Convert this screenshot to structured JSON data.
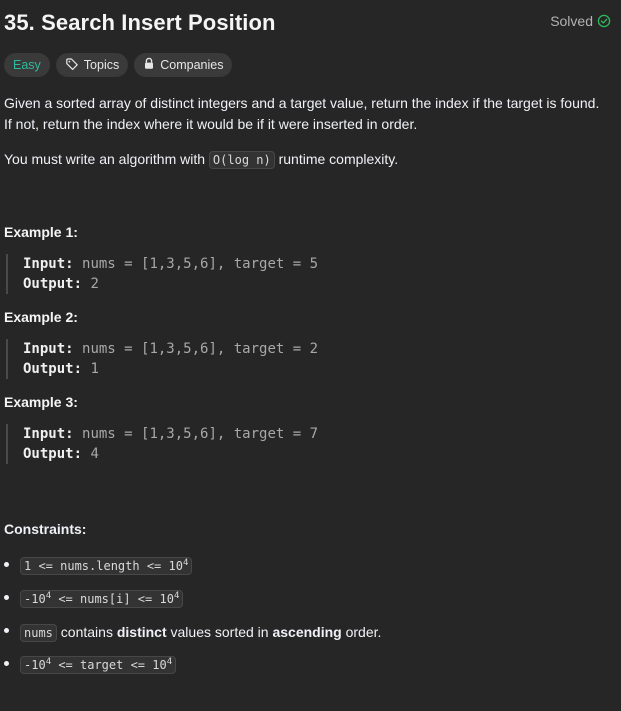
{
  "header": {
    "title": "35. Search Insert Position",
    "solved_label": "Solved"
  },
  "tags": {
    "difficulty": "Easy",
    "topics": "Topics",
    "companies": "Companies"
  },
  "description": {
    "line1": "Given a sorted array of distinct integers and a target value, return the index if the target is found.",
    "line2": "If not, return the index where it would be if it were inserted in order.",
    "p2_prefix": "You must write an algorithm with ",
    "p2_code": "O(log n)",
    "p2_suffix": " runtime complexity."
  },
  "examples": [
    {
      "title": "Example 1:",
      "input_label": "Input:",
      "input_value": "nums = [1,3,5,6], target = 5",
      "output_label": "Output:",
      "output_value": "2"
    },
    {
      "title": "Example 2:",
      "input_label": "Input:",
      "input_value": "nums = [1,3,5,6], target = 2",
      "output_label": "Output:",
      "output_value": "1"
    },
    {
      "title": "Example 3:",
      "input_label": "Input:",
      "input_value": "nums = [1,3,5,6], target = 7",
      "output_label": "Output:",
      "output_value": "4"
    }
  ],
  "constraints": {
    "title": "Constraints:",
    "c1_pre": "1 <= nums.length <= 10",
    "c1_exp": "4",
    "c2_a": "-10",
    "c2_a_exp": "4",
    "c2_b": " <= nums[i] <= 10",
    "c2_b_exp": "4",
    "c3_code": "nums",
    "c3_t1": " contains ",
    "c3_b1": "distinct",
    "c3_t2": " values sorted in ",
    "c3_b2": "ascending",
    "c3_t3": " order.",
    "c4_a": "-10",
    "c4_a_exp": "4",
    "c4_b": " <= target <= 10",
    "c4_b_exp": "4"
  },
  "colors": {
    "background": "#262626",
    "easy": "#2cbb9d",
    "solved_check": "#2cbb5d"
  }
}
